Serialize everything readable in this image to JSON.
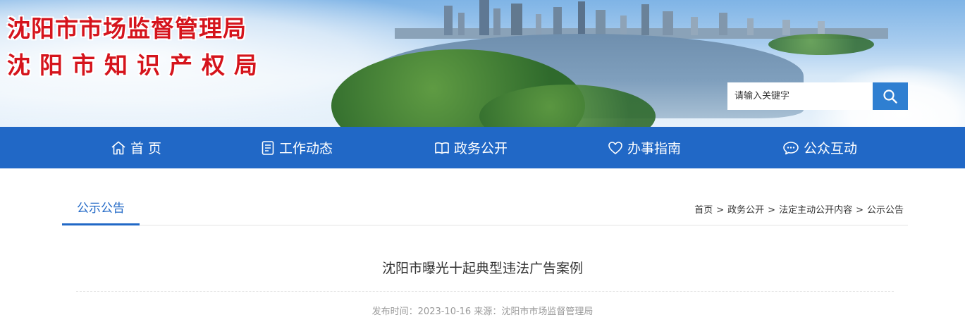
{
  "header": {
    "title_line1": "沈阳市市场监督管理局",
    "title_line2": "沈阳市知识产权局"
  },
  "search": {
    "placeholder": "请输入关键字",
    "icon": "search-icon"
  },
  "nav": {
    "items": [
      {
        "label": "首 页",
        "icon": "home-icon"
      },
      {
        "label": "工作动态",
        "icon": "document-icon"
      },
      {
        "label": "政务公开",
        "icon": "book-icon"
      },
      {
        "label": "办事指南",
        "icon": "heart-icon"
      },
      {
        "label": "公众互动",
        "icon": "chat-icon"
      }
    ]
  },
  "section": {
    "title": "公示公告"
  },
  "breadcrumb": {
    "items": [
      "首页",
      "政务公开",
      "法定主动公开内容",
      "公示公告"
    ],
    "separator": ">"
  },
  "article": {
    "title": "沈阳市曝光十起典型违法广告案例",
    "meta": "发布时间：2023-10-16 来源：沈阳市市场监督管理局"
  },
  "colors": {
    "nav_bg": "#2168c6",
    "title_red": "#d5141c",
    "search_button": "#2f7fd1"
  }
}
